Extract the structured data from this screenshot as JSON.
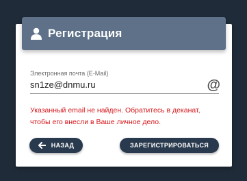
{
  "header": {
    "title": "Регистрация",
    "icon": "user-icon"
  },
  "email": {
    "label": "Электронная почта (E-Mail)",
    "value": "sn1ze@dnmu.ru",
    "icon": "at-icon",
    "icon_glyph": "@"
  },
  "error": {
    "message": "Указанный email не найден. Обратитесь в деканат, чтобы его внесли в Ваше личное дело."
  },
  "buttons": {
    "back": "НАЗАД",
    "register": "ЗАРЕГИСТРИРОВАТЬСЯ"
  },
  "colors": {
    "background": "#1f2b38",
    "header": "#5e7189",
    "button": "#2a3a4e",
    "error": "#d6161a"
  }
}
